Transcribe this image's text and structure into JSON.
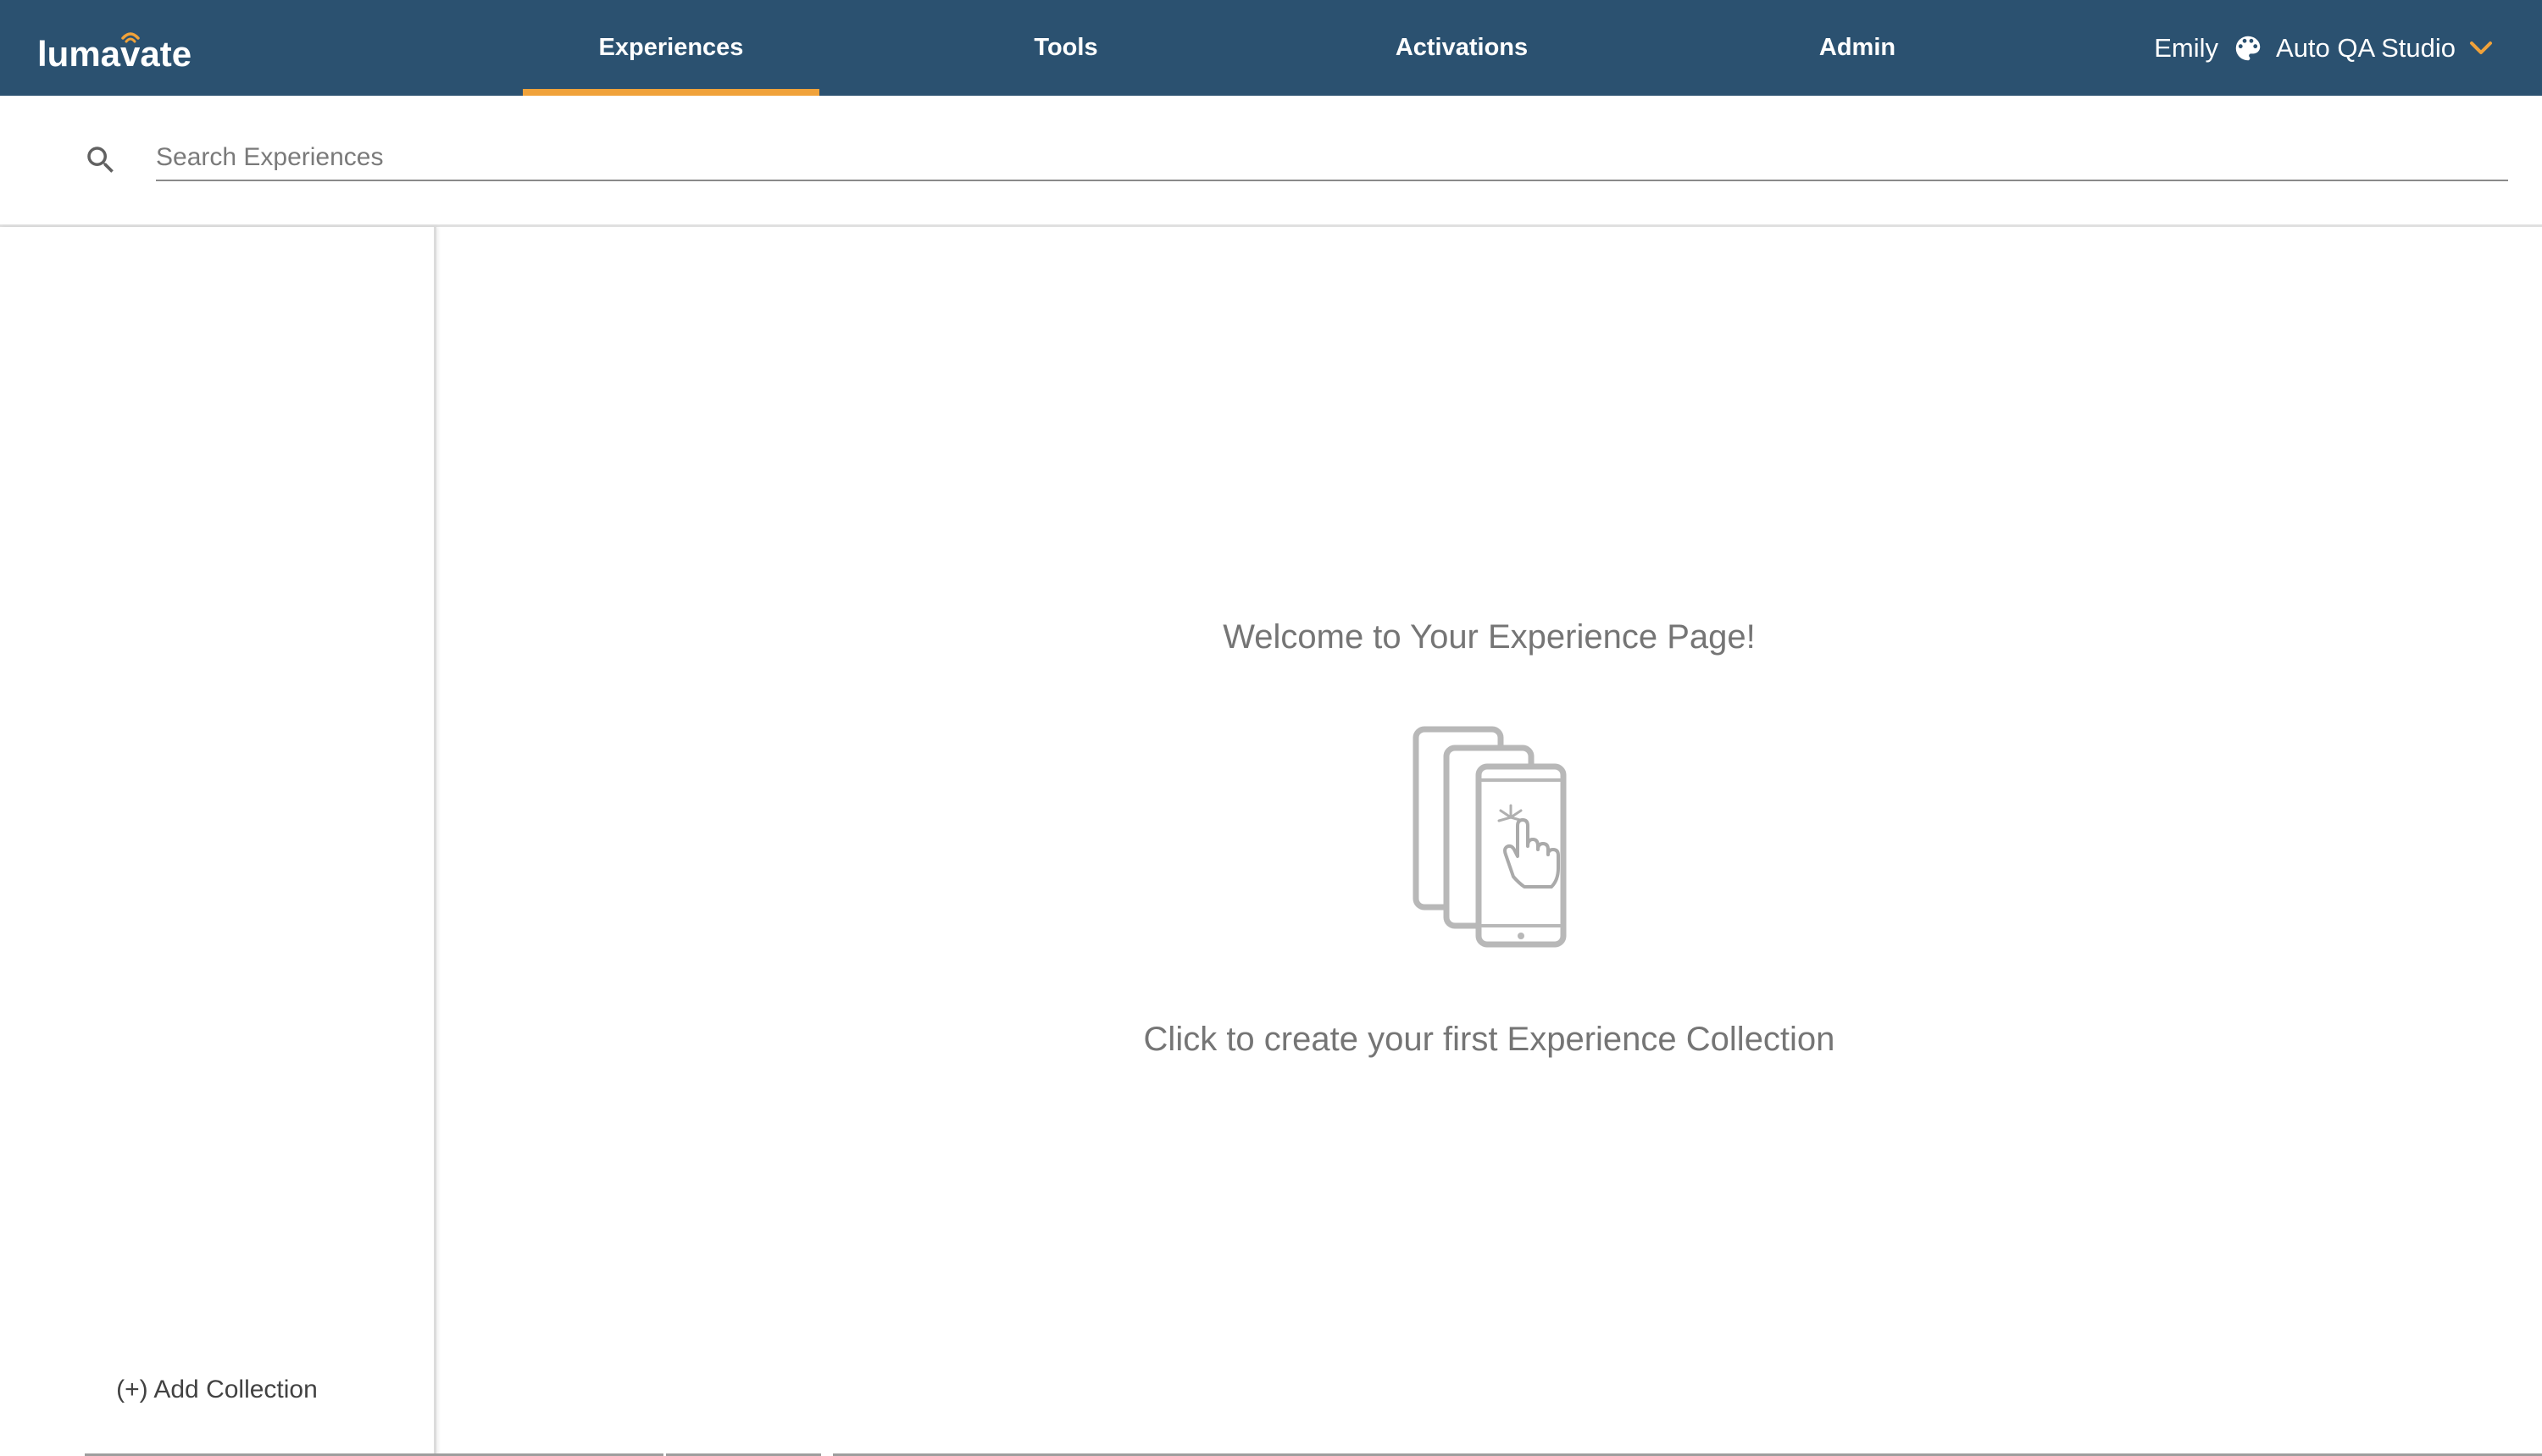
{
  "header": {
    "logo_text": "lumavate",
    "nav": [
      {
        "label": "Experiences",
        "active": true
      },
      {
        "label": "Tools",
        "active": false
      },
      {
        "label": "Activations",
        "active": false
      },
      {
        "label": "Admin",
        "active": false
      }
    ],
    "user_name": "Emily",
    "studio_name": "Auto QA Studio"
  },
  "search": {
    "placeholder": "Search Experiences",
    "value": ""
  },
  "sidebar": {
    "add_collection_label": "(+) Add Collection"
  },
  "main": {
    "welcome_title": "Welcome to Your Experience Page!",
    "create_prompt": "Click to create your first Experience Collection"
  },
  "colors": {
    "header_bg": "#2b5170",
    "accent": "#f0a23a",
    "muted_text": "#757575"
  },
  "icons": [
    "palette-icon",
    "chevron-down-icon",
    "search-icon",
    "phones-tap-icon"
  ]
}
